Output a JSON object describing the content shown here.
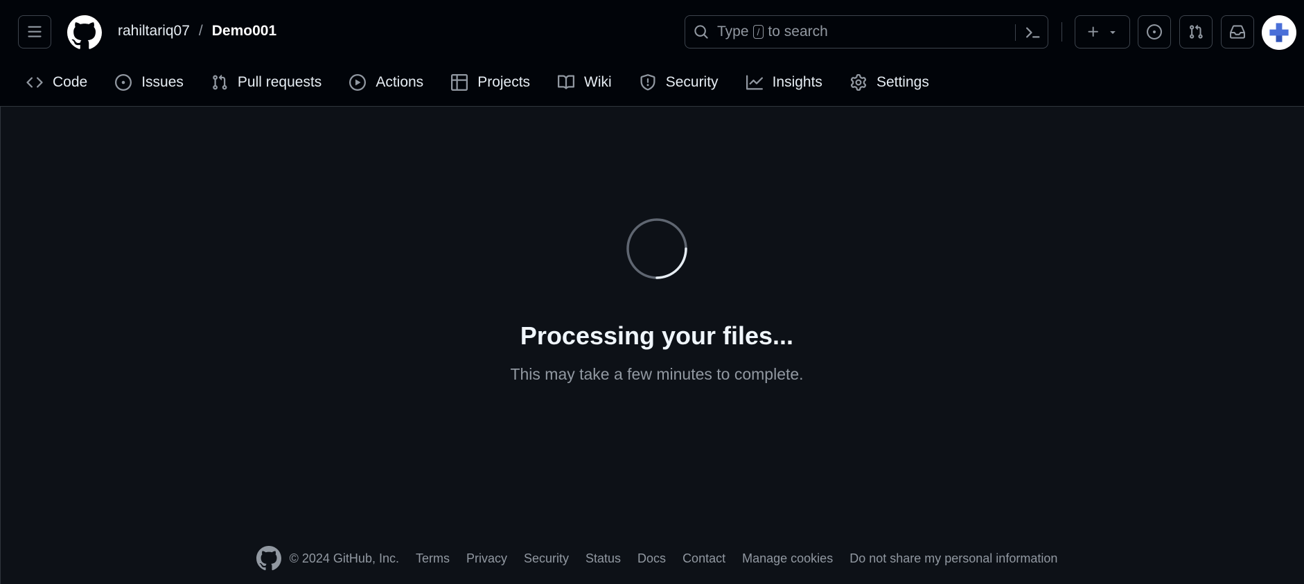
{
  "header": {
    "owner": "rahiltariq07",
    "separator": "/",
    "repo": "Demo001",
    "search": {
      "text_before": "Type",
      "kbd": "/",
      "text_after": "to search"
    },
    "icons": [
      "hamburger-icon",
      "github-logo-icon",
      "search-icon",
      "command-palette-icon",
      "plus-icon",
      "triangle-down-icon",
      "issue-opened-icon",
      "git-pull-request-icon",
      "inbox-icon",
      "avatar"
    ]
  },
  "nav": {
    "items": [
      {
        "label": "Code",
        "icon": "code-icon"
      },
      {
        "label": "Issues",
        "icon": "issue-opened-icon"
      },
      {
        "label": "Pull requests",
        "icon": "git-pull-request-icon"
      },
      {
        "label": "Actions",
        "icon": "play-icon"
      },
      {
        "label": "Projects",
        "icon": "table-icon"
      },
      {
        "label": "Wiki",
        "icon": "book-icon"
      },
      {
        "label": "Security",
        "icon": "shield-icon"
      },
      {
        "label": "Insights",
        "icon": "graph-icon"
      },
      {
        "label": "Settings",
        "icon": "gear-icon"
      }
    ]
  },
  "main": {
    "title": "Processing your files...",
    "subtitle": "This may take a few minutes to complete."
  },
  "footer": {
    "copyright": "© 2024 GitHub, Inc.",
    "links": [
      "Terms",
      "Privacy",
      "Security",
      "Status",
      "Docs",
      "Contact",
      "Manage cookies",
      "Do not share my personal information"
    ]
  },
  "colors": {
    "page_bg": "#0d1117",
    "header_bg": "#010409",
    "text": "#e6edf3",
    "muted": "#9198a1",
    "border": "#3d444d",
    "avatar_accent": "#4a6fd8"
  }
}
